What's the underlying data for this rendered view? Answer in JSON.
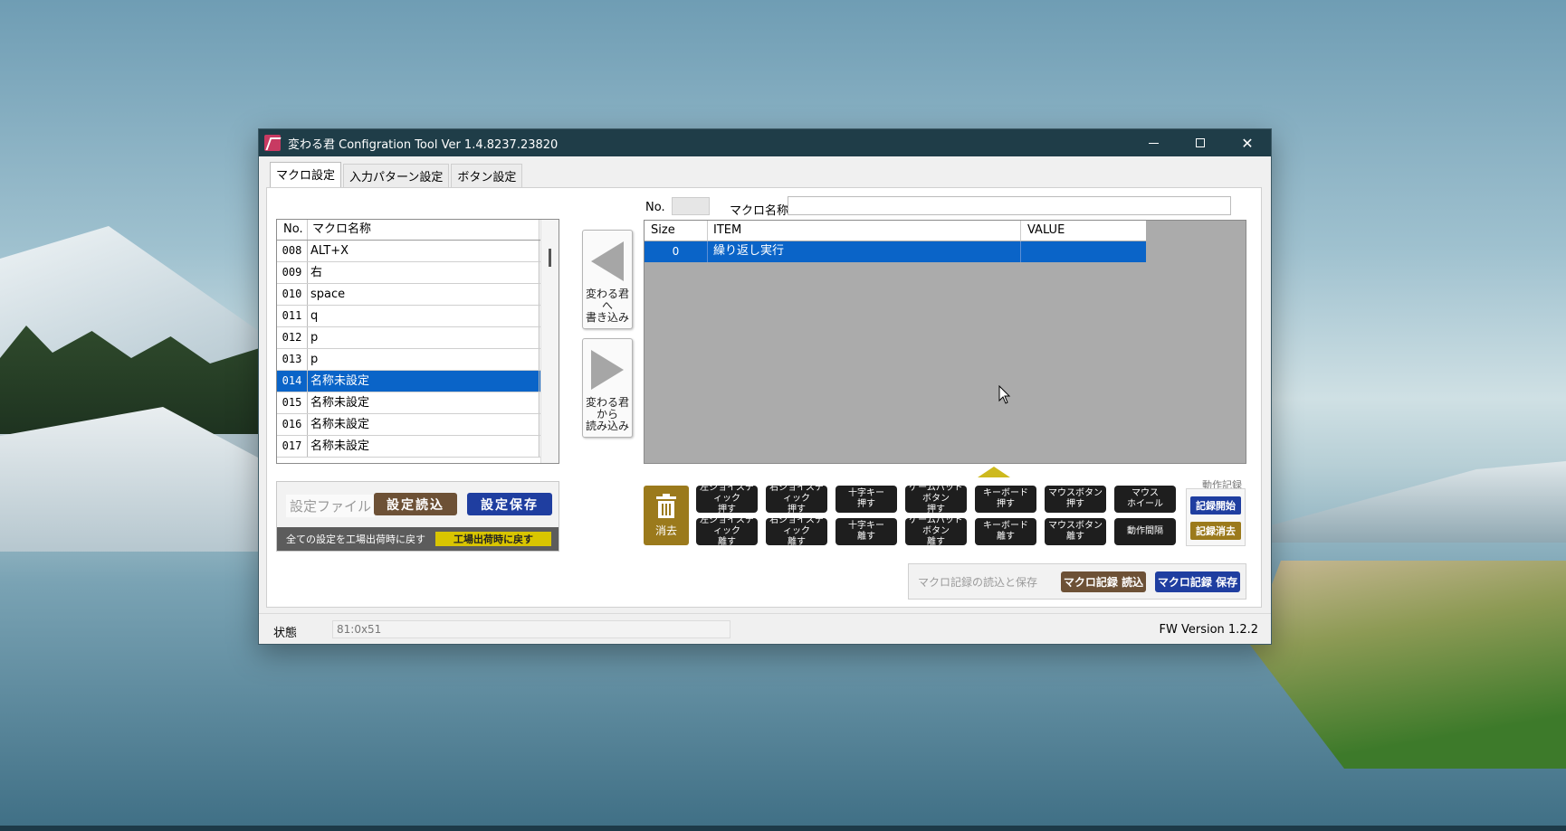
{
  "window": {
    "title": "変わる君 Configration Tool Ver 1.4.8237.23820",
    "minimize": "",
    "maximize": "",
    "close": "✕"
  },
  "tabs": [
    {
      "label": "マクロ設定"
    },
    {
      "label": "入力パターン設定"
    },
    {
      "label": "ボタン設定"
    }
  ],
  "macro_list": {
    "headers": {
      "no": "No.",
      "name": "マクロ名称"
    },
    "rows": [
      {
        "no": "008",
        "name": "ALT+X"
      },
      {
        "no": "009",
        "name": "右"
      },
      {
        "no": "010",
        "name": "space"
      },
      {
        "no": "011",
        "name": "q"
      },
      {
        "no": "012",
        "name": "p"
      },
      {
        "no": "013",
        "name": "p"
      },
      {
        "no": "014",
        "name": "名称未設定"
      },
      {
        "no": "015",
        "name": "名称未設定"
      },
      {
        "no": "016",
        "name": "名称未設定"
      },
      {
        "no": "017",
        "name": "名称未設定"
      }
    ],
    "selected_no": "014"
  },
  "transfer": {
    "write_label": "変わる君\nへ\n書き込み",
    "read_label": "変わる君\nから\n読み込み"
  },
  "settings_file": {
    "label": "設定ファイル",
    "load": "設定読込",
    "save": "設定保存",
    "reset_text": "全ての設定を工場出荷時に戻す",
    "reset_button": "工場出荷時に戻す"
  },
  "macro_header": {
    "no_label": "No.",
    "no_value": "",
    "name_label": "マクロ名称",
    "name_value": ""
  },
  "item_table": {
    "headers": {
      "size": "Size",
      "item": "ITEM",
      "value": "VALUE"
    },
    "rows": [
      {
        "size": "0",
        "item": "繰り返し実行",
        "value": ""
      }
    ]
  },
  "actions": {
    "delete": "消去",
    "buttons": [
      {
        "label": "左ジョイスティック\n押す"
      },
      {
        "label": "右ジョイスティック\n押す"
      },
      {
        "label": "十字キー\n押す"
      },
      {
        "label": "ゲームパッドボタン\n押す"
      },
      {
        "label": "キーボード\n押す"
      },
      {
        "label": "マウスボタン\n押す"
      },
      {
        "label": "マウス\nホイール"
      },
      {
        "label": "左ジョイスティック\n離す"
      },
      {
        "label": "右ジョイスティック\n離す"
      },
      {
        "label": "十字キー\n離す"
      },
      {
        "label": "ゲームパッドボタン\n離す"
      },
      {
        "label": "キーボード\n離す"
      },
      {
        "label": "マウスボタン\n離す"
      },
      {
        "label": "動作間隔"
      }
    ]
  },
  "record": {
    "title": "動作記録",
    "start": "記録開始",
    "clear": "記録消去"
  },
  "macro_file": {
    "label": "マクロ記録の読込と保存",
    "load": "マクロ記録 読込",
    "save": "マクロ記録 保存"
  },
  "status": {
    "label": "状態",
    "value": "81:0x51",
    "fw_version": "FW Version  1.2.2"
  },
  "colors": {
    "selection": "#0a64c8",
    "titlebar": "#1f3d48",
    "brown": "#6d5136",
    "navy": "#1f3ea0",
    "gold": "#9b7a1c",
    "yellow": "#d9c500"
  }
}
